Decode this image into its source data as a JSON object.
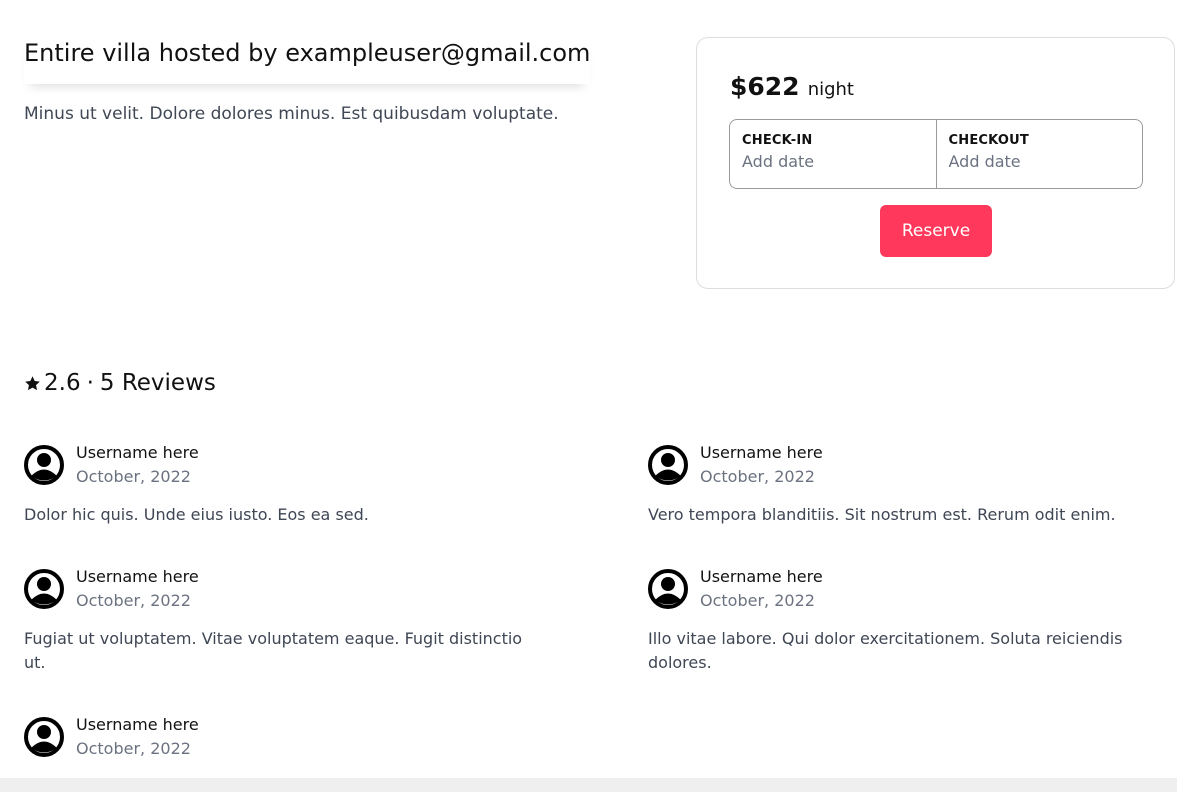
{
  "listing": {
    "title": "Entire villa hosted by exampleuser@gmail.com",
    "description": "Minus ut velit. Dolore dolores minus. Est quibusdam voluptate."
  },
  "booking": {
    "price": "$622",
    "price_unit": "night",
    "checkin_label": "CHECK-IN",
    "checkin_value": "Add date",
    "checkout_label": "CHECKOUT",
    "checkout_value": "Add date",
    "reserve_label": "Reserve",
    "accent_color": "#ff385c"
  },
  "reviews_summary": {
    "rating": "2.6",
    "separator": "·",
    "count_label": "5 Reviews",
    "star_icon": "star-icon"
  },
  "reviews": [
    {
      "user": "Username here",
      "date": "October, 2022",
      "text": "Dolor hic quis. Unde eius iusto. Eos ea sed.",
      "avatar_icon": "user-avatar-icon"
    },
    {
      "user": "Username here",
      "date": "October, 2022",
      "text": "Vero tempora blanditiis. Sit nostrum est. Rerum odit enim.",
      "avatar_icon": "user-avatar-icon"
    },
    {
      "user": "Username here",
      "date": "October, 2022",
      "text": "Fugiat ut voluptatem. Vitae voluptatem eaque. Fugit distinctio ut.",
      "avatar_icon": "user-avatar-icon"
    },
    {
      "user": "Username here",
      "date": "October, 2022",
      "text": "Illo vitae labore. Qui dolor exercitationem. Soluta reiciendis dolores.",
      "avatar_icon": "user-avatar-icon"
    },
    {
      "user": "Username here",
      "date": "October, 2022",
      "text": "",
      "avatar_icon": "user-avatar-icon"
    }
  ]
}
